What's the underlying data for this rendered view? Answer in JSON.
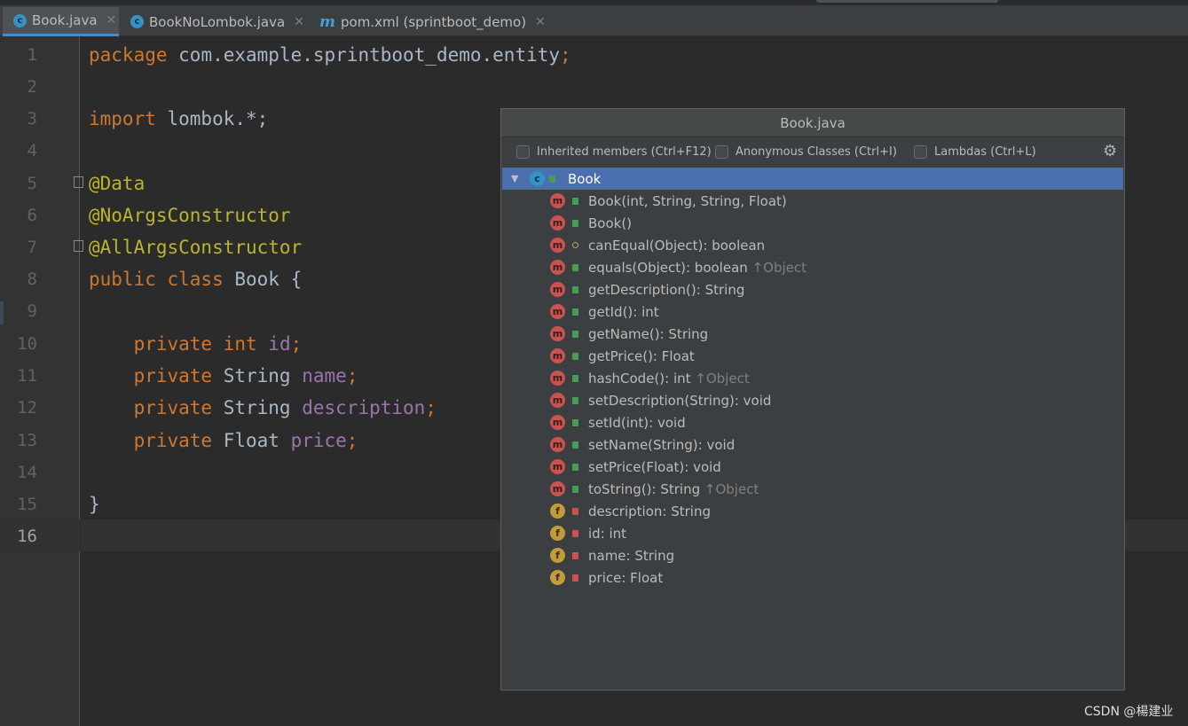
{
  "tabs": [
    {
      "label": "Book.java",
      "icon": "class-icon",
      "active": true
    },
    {
      "label": "BookNoLombok.java",
      "icon": "class-icon",
      "active": false
    },
    {
      "label": "pom.xml (sprintboot_demo)",
      "icon": "maven-icon",
      "active": false
    }
  ],
  "editor": {
    "line_numbers": [
      "1",
      "2",
      "3",
      "4",
      "5",
      "6",
      "7",
      "8",
      "9",
      "10",
      "11",
      "12",
      "13",
      "14",
      "15",
      "16"
    ],
    "current_line": "16",
    "lines": {
      "l1a": "package",
      "l1b": " com.example.sprintboot_demo.entity",
      "l1c": ";",
      "l3a": "import",
      "l3b": " lombok.*;",
      "l5": "@Data",
      "l6": "@NoArgsConstructor",
      "l7": "@AllArgsConstructor",
      "l8a": "public class",
      "l8b": " Book {",
      "l10a": "    private int",
      "l10b": " id",
      "l10c": ";",
      "l11a": "    private",
      "l11b": " String",
      "l11c": " name",
      "l11d": ";",
      "l12a": "    private",
      "l12b": " String",
      "l12c": " description",
      "l12d": ";",
      "l13a": "    private",
      "l13b": " Float",
      "l13c": " price",
      "l13d": ";",
      "l15": "}"
    }
  },
  "popup": {
    "title": "Book.java",
    "options": {
      "inherited": "Inherited members (Ctrl+F12)",
      "anonymous": "Anonymous Classes (Ctrl+I)",
      "lambdas": "Lambdas (Ctrl+L)"
    },
    "root": "Book",
    "members": [
      {
        "kind": "m",
        "vis": "pub",
        "label": "Book(int, String, String, Float)",
        "inherited": ""
      },
      {
        "kind": "m",
        "vis": "pub",
        "label": "Book()",
        "inherited": ""
      },
      {
        "kind": "m",
        "vis": "prot",
        "label": "canEqual(Object): boolean",
        "inherited": ""
      },
      {
        "kind": "m",
        "vis": "pub",
        "label": "equals(Object): boolean",
        "inherited": "↑Object"
      },
      {
        "kind": "m",
        "vis": "pub",
        "label": "getDescription(): String",
        "inherited": ""
      },
      {
        "kind": "m",
        "vis": "pub",
        "label": "getId(): int",
        "inherited": ""
      },
      {
        "kind": "m",
        "vis": "pub",
        "label": "getName(): String",
        "inherited": ""
      },
      {
        "kind": "m",
        "vis": "pub",
        "label": "getPrice(): Float",
        "inherited": ""
      },
      {
        "kind": "m",
        "vis": "pub",
        "label": "hashCode(): int",
        "inherited": "↑Object"
      },
      {
        "kind": "m",
        "vis": "pub",
        "label": "setDescription(String): void",
        "inherited": ""
      },
      {
        "kind": "m",
        "vis": "pub",
        "label": "setId(int): void",
        "inherited": ""
      },
      {
        "kind": "m",
        "vis": "pub",
        "label": "setName(String): void",
        "inherited": ""
      },
      {
        "kind": "m",
        "vis": "pub",
        "label": "setPrice(Float): void",
        "inherited": ""
      },
      {
        "kind": "m",
        "vis": "pub",
        "label": "toString(): String",
        "inherited": "↑Object"
      },
      {
        "kind": "f",
        "vis": "priv",
        "label": "description: String",
        "inherited": ""
      },
      {
        "kind": "f",
        "vis": "priv",
        "label": "id: int",
        "inherited": ""
      },
      {
        "kind": "f",
        "vis": "priv",
        "label": "name: String",
        "inherited": ""
      },
      {
        "kind": "f",
        "vis": "priv",
        "label": "price: Float",
        "inherited": ""
      }
    ]
  },
  "watermark": "CSDN @楊建业",
  "colors": {
    "keyword": "#cc7832",
    "annotation": "#bbb529",
    "field": "#9876aa",
    "selection": "#4b6eaf"
  }
}
